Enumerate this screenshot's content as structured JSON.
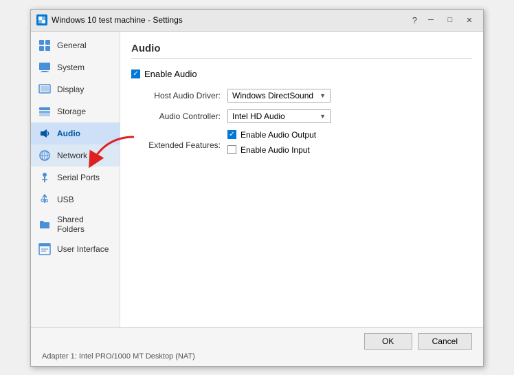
{
  "window": {
    "title": "Windows 10 test machine - Settings",
    "icon": "⚙"
  },
  "titlebar": {
    "help_label": "?",
    "minimize_label": "─",
    "maximize_label": "□",
    "close_label": "✕"
  },
  "sidebar": {
    "items": [
      {
        "id": "general",
        "label": "General",
        "icon": "general"
      },
      {
        "id": "system",
        "label": "System",
        "icon": "system"
      },
      {
        "id": "display",
        "label": "Display",
        "icon": "display"
      },
      {
        "id": "storage",
        "label": "Storage",
        "icon": "storage"
      },
      {
        "id": "audio",
        "label": "Audio",
        "icon": "audio",
        "active": true
      },
      {
        "id": "network",
        "label": "Network",
        "icon": "network"
      },
      {
        "id": "serial-ports",
        "label": "Serial Ports",
        "icon": "serial"
      },
      {
        "id": "usb",
        "label": "USB",
        "icon": "usb"
      },
      {
        "id": "shared-folders",
        "label": "Shared Folders",
        "icon": "folder"
      },
      {
        "id": "user-interface",
        "label": "User Interface",
        "icon": "ui"
      }
    ]
  },
  "main": {
    "section_title": "Audio",
    "enable_audio_label": "Enable Audio",
    "host_audio_driver_label": "Host Audio Driver:",
    "host_audio_driver_value": "Windows DirectSound",
    "audio_controller_label": "Audio Controller:",
    "audio_controller_value": "Intel HD Audio",
    "extended_features_label": "Extended Features:",
    "enable_audio_output_label": "Enable Audio Output",
    "enable_audio_input_label": "Enable Audio Input"
  },
  "footer": {
    "status": "Adapter 1:   Intel PRO/1000 MT Desktop (NAT)",
    "ok_label": "OK",
    "cancel_label": "Cancel"
  }
}
